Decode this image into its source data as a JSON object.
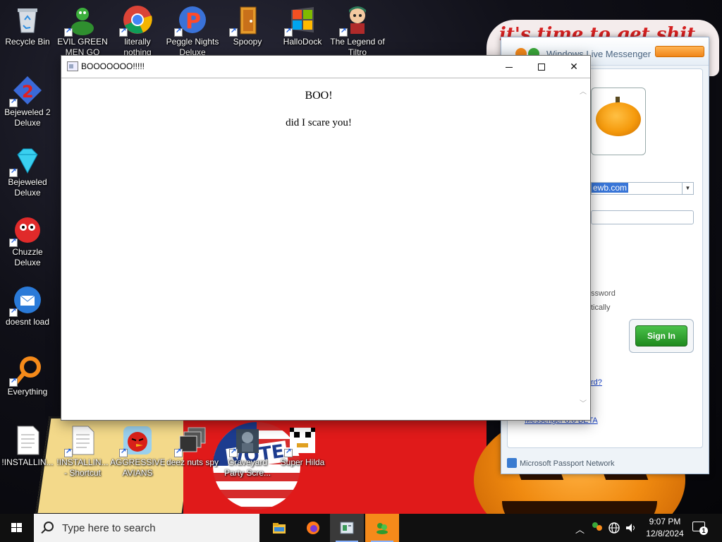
{
  "wallpaper": {
    "banner_text": "it's time to get shit",
    "sticker_text": "VOTE"
  },
  "desktop_icons": [
    {
      "id": "recycle-bin",
      "label": "Recycle Bin",
      "icon": "recycle-bin-icon",
      "shortcut": false
    },
    {
      "id": "evil-green",
      "label": "EVIL GREEN MEN GO",
      "icon": "green-men-icon",
      "shortcut": true
    },
    {
      "id": "literally",
      "label": "literally nothing",
      "icon": "chrome-icon",
      "shortcut": true
    },
    {
      "id": "peggle",
      "label": "Peggle Nights Deluxe",
      "icon": "peggle-icon",
      "shortcut": true
    },
    {
      "id": "spoopy",
      "label": "Spoopy",
      "icon": "door-icon",
      "shortcut": true
    },
    {
      "id": "hallodock",
      "label": "HalloDock",
      "icon": "windows-logo-icon",
      "shortcut": true
    },
    {
      "id": "legend",
      "label": "The Legend of Tiltro",
      "icon": "adventurer-icon",
      "shortcut": true
    },
    {
      "id": "bejeweled2",
      "label": "Bejeweled 2 Deluxe",
      "icon": "bejeweled2-icon",
      "shortcut": true
    },
    {
      "id": "bejeweled",
      "label": "Bejeweled Deluxe",
      "icon": "diamond-icon",
      "shortcut": true
    },
    {
      "id": "chuzzle",
      "label": "Chuzzle Deluxe",
      "icon": "chuzzle-icon",
      "shortcut": true
    },
    {
      "id": "doesnt-load",
      "label": "doesnt load",
      "icon": "thunderbird-icon",
      "shortcut": true
    },
    {
      "id": "everything",
      "label": "Everything",
      "icon": "magnifier-icon",
      "shortcut": true
    },
    {
      "id": "installing",
      "label": "!INSTALLIN...",
      "icon": "text-file-icon",
      "shortcut": false
    },
    {
      "id": "installing-shortcut",
      "label": "!INSTALLIN... - Shortcut",
      "icon": "text-file-icon",
      "shortcut": true
    },
    {
      "id": "aggressive-avians",
      "label": "AGGRESSIVE AVIANS",
      "icon": "angry-bird-icon",
      "shortcut": true
    },
    {
      "id": "deez-nuts",
      "label": "deez nuts spy",
      "icon": "stacked-windows-icon",
      "shortcut": true
    },
    {
      "id": "graveyard",
      "label": "Graveyard Party Scre...",
      "icon": "graveyard-icon",
      "shortcut": true
    },
    {
      "id": "super-hilda",
      "label": "Super Hilda",
      "icon": "pixel-character-icon",
      "shortcut": true
    }
  ],
  "messenger": {
    "title": "Windows Live Messenger",
    "email_value": "ewb.com",
    "remember_password": "ssword",
    "auto_sign_in": "tically",
    "sign_in": "Sign In",
    "forgot_link": "rd?",
    "beta_link": "Messenger 8.0 BETA",
    "footer": "Microsoft Passport Network"
  },
  "boo_window": {
    "title": "BOOOOOOO!!!!!",
    "heading": "BOO!",
    "body": "did I scare you!"
  },
  "taskbar": {
    "search_placeholder": "Type here to search",
    "apps": [
      "file-explorer-icon",
      "firefox-icon",
      "html-viewer-icon",
      "messenger-icon"
    ],
    "time": "9:07 PM",
    "date": "12/8/2024",
    "notification_count": "1"
  }
}
